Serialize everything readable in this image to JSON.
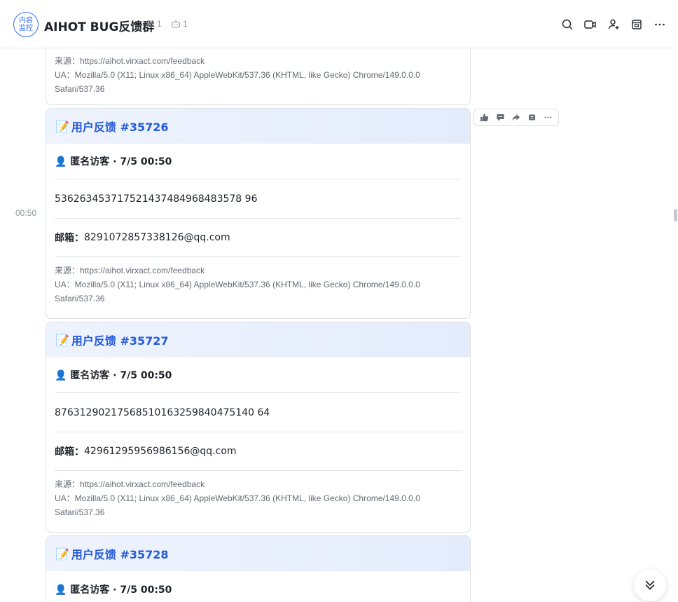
{
  "header": {
    "avatar_line1": "内容",
    "avatar_line2": "监控",
    "title": "AIHOT BUG反馈群",
    "members_count": "1",
    "bots_count": "1"
  },
  "chat": {
    "time_label": "00:50",
    "top_card": {
      "source": "来源：https://aihot.virxact.com/feedback",
      "ua_line1": "UA：Mozilla/5.0 (X11; Linux x86_64) AppleWebKit/537.36 (KHTML, like Gecko) Chrome/149.0.0.0",
      "ua_line2": "Safari/537.36"
    },
    "cards": [
      {
        "emoji": "📝",
        "title": "用户反馈 #35726",
        "user": "👤 匿名访客 · 7/5 00:50",
        "content": "536263453717521437484968483578 96",
        "email_label": "邮箱：",
        "email": "8291072857338126@qq.com",
        "source": "来源：https://aihot.virxact.com/feedback",
        "ua_line1": "UA：Mozilla/5.0 (X11; Linux x86_64) AppleWebKit/537.36 (KHTML, like Gecko) Chrome/149.0.0.0",
        "ua_line2": "Safari/537.36"
      },
      {
        "emoji": "📝",
        "title": "用户反馈 #35727",
        "user": "👤 匿名访客 · 7/5 00:50",
        "content": "87631290217568510163259840475140 64",
        "email_label": "邮箱：",
        "email": "42961295956986156@qq.com",
        "source": "来源：https://aihot.virxact.com/feedback",
        "ua_line1": "UA：Mozilla/5.0 (X11; Linux x86_64) AppleWebKit/537.36 (KHTML, like Gecko) Chrome/149.0.0.0",
        "ua_line2": "Safari/537.36"
      },
      {
        "emoji": "📝",
        "title": "用户反馈 #35728",
        "user": "👤 匿名访客 · 7/5 00:50"
      }
    ]
  },
  "icons": {
    "header": [
      "search-icon",
      "video-call-icon",
      "add-member-icon",
      "calendar-icon",
      "more-icon"
    ],
    "actions": [
      "thumbs-up-icon",
      "reply-icon",
      "forward-icon",
      "pin-icon",
      "more-icon"
    ]
  },
  "colors": {
    "accent": "#245bdb",
    "avatar": "#3370ff",
    "muted": "#8f959e"
  }
}
